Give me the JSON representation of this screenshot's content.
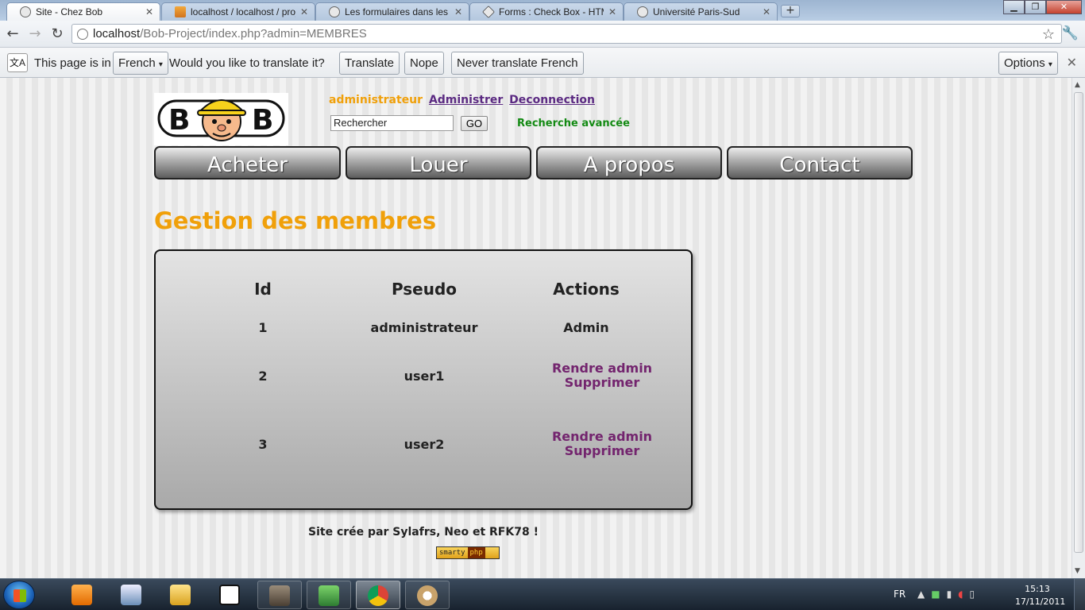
{
  "browser": {
    "tabs": [
      {
        "label": "Site - Chez Bob",
        "active": true,
        "icon": "globe-icon"
      },
      {
        "label": "localhost / localhost / proje",
        "active": false,
        "icon": "phpmyadmin-icon"
      },
      {
        "label": "Les formulaires dans les doc",
        "active": false,
        "icon": "globe-icon"
      },
      {
        "label": "Forms : Check Box - HTML",
        "active": false,
        "icon": "diamond-icon"
      },
      {
        "label": "Université Paris-Sud",
        "active": false,
        "icon": "globe-icon"
      }
    ],
    "address": {
      "host": "localhost",
      "path": "/Bob-Project/index.php?admin=MEMBRES"
    },
    "translate_bar": {
      "prefix": "This page is in",
      "language": "French",
      "question": "Would you like to translate it?",
      "translate_label": "Translate",
      "nope_label": "Nope",
      "never_label": "Never translate French",
      "options_label": "Options"
    }
  },
  "site": {
    "username": "administrateur",
    "admin_link": "Administrer",
    "logout_link": "Deconnection",
    "search_value": "Rechercher",
    "go_label": "GO",
    "advanced_search": "Recherche avancée",
    "menu": [
      "Acheter",
      "Louer",
      "A propos",
      "Contact"
    ],
    "page_title": "Gestion des membres",
    "table": {
      "headers": [
        "Id",
        "Pseudo",
        "Actions"
      ],
      "rows": [
        {
          "id": "1",
          "pseudo": "administrateur",
          "actions": [
            "Admin"
          ]
        },
        {
          "id": "2",
          "pseudo": "user1",
          "actions": [
            "Rendre admin",
            "Supprimer"
          ]
        },
        {
          "id": "3",
          "pseudo": "user2",
          "actions": [
            "Rendre admin",
            "Supprimer"
          ]
        }
      ]
    },
    "footer": "Site crée par Sylafrs, Neo et RFK78 !",
    "smarty_badge": [
      "smarty",
      "php"
    ]
  },
  "taskbar": {
    "language": "FR",
    "time": "15:13",
    "date": "17/11/2011"
  },
  "colors": {
    "username": "#f0a00a",
    "title": "#f0a00a",
    "link": "#5b2a82",
    "action_link": "#73246e",
    "advanced_search": "#138a13"
  }
}
